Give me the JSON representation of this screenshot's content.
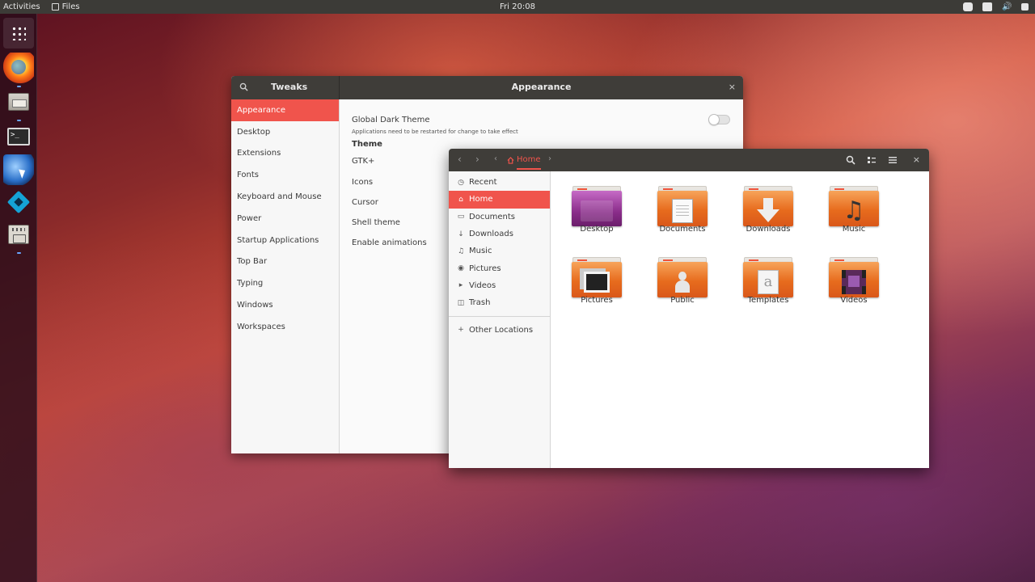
{
  "topbar": {
    "activities": "Activities",
    "app_menu": "Files",
    "clock": "Fri 20:08",
    "tray_icons": [
      "battery-icon",
      "record-icon",
      "volume-icon",
      "power-icon"
    ]
  },
  "dock": {
    "items": [
      "show-applications",
      "firefox",
      "files",
      "terminal",
      "web-browser",
      "kodi",
      "tweaks"
    ]
  },
  "tweaks": {
    "title": "Tweaks",
    "page_title": "Appearance",
    "close": "×",
    "sidebar": [
      "Appearance",
      "Desktop",
      "Extensions",
      "Fonts",
      "Keyboard and Mouse",
      "Power",
      "Startup Applications",
      "Top Bar",
      "Typing",
      "Windows",
      "Workspaces"
    ],
    "active": "Appearance",
    "global_dark_theme": "Global Dark Theme",
    "global_dark_theme_note": "Applications need to be restarted for change to take effect",
    "global_dark_theme_enabled": false,
    "theme_heading": "Theme",
    "theme_rows": [
      "GTK+",
      "Icons",
      "Cursor",
      "Shell theme",
      "Enable animations"
    ]
  },
  "files": {
    "path": "Home",
    "close": "×",
    "sidebar": [
      "Recent",
      "Home",
      "Documents",
      "Downloads",
      "Music",
      "Pictures",
      "Videos",
      "Trash"
    ],
    "active": "Home",
    "other_locations": "Other Locations",
    "folders": [
      "Desktop",
      "Documents",
      "Downloads",
      "Music",
      "Pictures",
      "Public",
      "Templates",
      "Videos"
    ]
  },
  "colors": {
    "accent": "#f0544c",
    "header": "#3f3d39",
    "panel": "#3c3b37",
    "folder": "#e76b1d"
  }
}
